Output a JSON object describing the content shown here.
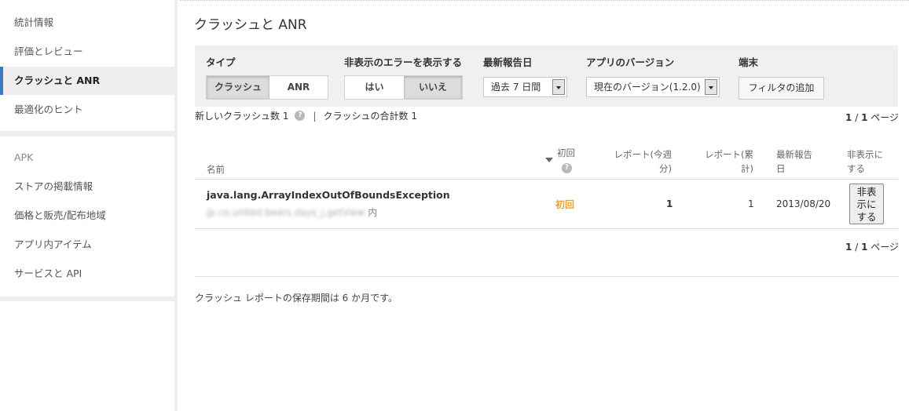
{
  "sidebar": {
    "group1": [
      {
        "label": "統計情報"
      },
      {
        "label": "評価とレビュー"
      },
      {
        "label": "クラッシュと ANR",
        "active": true
      },
      {
        "label": "最適化のヒント"
      }
    ],
    "group2": [
      {
        "label": "APK"
      },
      {
        "label": "ストアの掲載情報"
      },
      {
        "label": "価格と販売/配布地域"
      },
      {
        "label": "アプリ内アイテム"
      },
      {
        "label": "サービスと API"
      }
    ]
  },
  "page": {
    "title": "クラッシュと ANR"
  },
  "filters": {
    "type_label": "タイプ",
    "type_options": [
      "クラッシュ",
      "ANR"
    ],
    "type_selected": "クラッシュ",
    "hidden_label": "非表示のエラーを表示する",
    "hidden_options": [
      "はい",
      "いいえ"
    ],
    "hidden_selected": "いいえ",
    "last_report_label": "最新報告日",
    "last_report_value": "過去 7 日間",
    "version_label": "アプリのバージョン",
    "version_value": "現在のバージョン(1.2.0)",
    "device_label": "端末",
    "add_filter": "フィルタの追加"
  },
  "summary": {
    "new_label": "新しいクラッシュ数",
    "new_count": "1",
    "total_label": "クラッシュの合計数",
    "total_count": "1",
    "separator": "|"
  },
  "pager": {
    "current": "1",
    "slash": " / ",
    "total": "1",
    "suffix": " ページ"
  },
  "table": {
    "headers": {
      "name": "名前",
      "first": "初回",
      "reports_week_1": "レポート(今週",
      "reports_week_2": "分)",
      "reports_total_1": "レポート(累",
      "reports_total_2": "計)",
      "last_1": "最新報告",
      "last_2": "日",
      "hide_1": "非表示に",
      "hide_2": "する"
    },
    "rows": [
      {
        "name": "java.lang.ArrayIndexOutOfBoundsException",
        "location": "jp.co.united.bears.days_j.getView",
        "location_suffix": "内",
        "first": "初回",
        "reports_week": "1",
        "reports_total": "1",
        "last_reported": "2013/08/20",
        "hide_label_1": "非表",
        "hide_label_2": "示に",
        "hide_label_3": "する"
      }
    ]
  },
  "footer": {
    "retention": "クラッシュ レポートの保存期間は 6 か月です。"
  },
  "colors": {
    "accent": "#3b7bbf",
    "first_badge": "#f0a030"
  }
}
